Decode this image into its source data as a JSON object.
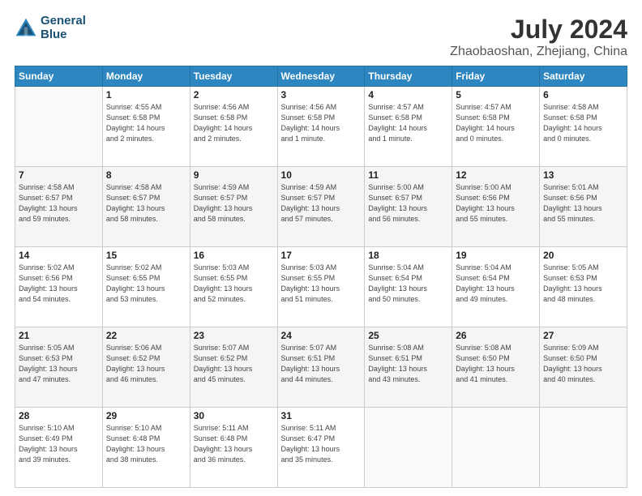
{
  "header": {
    "logo_line1": "General",
    "logo_line2": "Blue",
    "title": "July 2024",
    "subtitle": "Zhaobaoshan, Zhejiang, China"
  },
  "days_of_week": [
    "Sunday",
    "Monday",
    "Tuesday",
    "Wednesday",
    "Thursday",
    "Friday",
    "Saturday"
  ],
  "weeks": [
    [
      {
        "day": "",
        "info": ""
      },
      {
        "day": "1",
        "info": "Sunrise: 4:55 AM\nSunset: 6:58 PM\nDaylight: 14 hours\nand 2 minutes."
      },
      {
        "day": "2",
        "info": "Sunrise: 4:56 AM\nSunset: 6:58 PM\nDaylight: 14 hours\nand 2 minutes."
      },
      {
        "day": "3",
        "info": "Sunrise: 4:56 AM\nSunset: 6:58 PM\nDaylight: 14 hours\nand 1 minute."
      },
      {
        "day": "4",
        "info": "Sunrise: 4:57 AM\nSunset: 6:58 PM\nDaylight: 14 hours\nand 1 minute."
      },
      {
        "day": "5",
        "info": "Sunrise: 4:57 AM\nSunset: 6:58 PM\nDaylight: 14 hours\nand 0 minutes."
      },
      {
        "day": "6",
        "info": "Sunrise: 4:58 AM\nSunset: 6:58 PM\nDaylight: 14 hours\nand 0 minutes."
      }
    ],
    [
      {
        "day": "7",
        "info": "Sunrise: 4:58 AM\nSunset: 6:57 PM\nDaylight: 13 hours\nand 59 minutes."
      },
      {
        "day": "8",
        "info": "Sunrise: 4:58 AM\nSunset: 6:57 PM\nDaylight: 13 hours\nand 58 minutes."
      },
      {
        "day": "9",
        "info": "Sunrise: 4:59 AM\nSunset: 6:57 PM\nDaylight: 13 hours\nand 58 minutes."
      },
      {
        "day": "10",
        "info": "Sunrise: 4:59 AM\nSunset: 6:57 PM\nDaylight: 13 hours\nand 57 minutes."
      },
      {
        "day": "11",
        "info": "Sunrise: 5:00 AM\nSunset: 6:57 PM\nDaylight: 13 hours\nand 56 minutes."
      },
      {
        "day": "12",
        "info": "Sunrise: 5:00 AM\nSunset: 6:56 PM\nDaylight: 13 hours\nand 55 minutes."
      },
      {
        "day": "13",
        "info": "Sunrise: 5:01 AM\nSunset: 6:56 PM\nDaylight: 13 hours\nand 55 minutes."
      }
    ],
    [
      {
        "day": "14",
        "info": "Sunrise: 5:02 AM\nSunset: 6:56 PM\nDaylight: 13 hours\nand 54 minutes."
      },
      {
        "day": "15",
        "info": "Sunrise: 5:02 AM\nSunset: 6:55 PM\nDaylight: 13 hours\nand 53 minutes."
      },
      {
        "day": "16",
        "info": "Sunrise: 5:03 AM\nSunset: 6:55 PM\nDaylight: 13 hours\nand 52 minutes."
      },
      {
        "day": "17",
        "info": "Sunrise: 5:03 AM\nSunset: 6:55 PM\nDaylight: 13 hours\nand 51 minutes."
      },
      {
        "day": "18",
        "info": "Sunrise: 5:04 AM\nSunset: 6:54 PM\nDaylight: 13 hours\nand 50 minutes."
      },
      {
        "day": "19",
        "info": "Sunrise: 5:04 AM\nSunset: 6:54 PM\nDaylight: 13 hours\nand 49 minutes."
      },
      {
        "day": "20",
        "info": "Sunrise: 5:05 AM\nSunset: 6:53 PM\nDaylight: 13 hours\nand 48 minutes."
      }
    ],
    [
      {
        "day": "21",
        "info": "Sunrise: 5:05 AM\nSunset: 6:53 PM\nDaylight: 13 hours\nand 47 minutes."
      },
      {
        "day": "22",
        "info": "Sunrise: 5:06 AM\nSunset: 6:52 PM\nDaylight: 13 hours\nand 46 minutes."
      },
      {
        "day": "23",
        "info": "Sunrise: 5:07 AM\nSunset: 6:52 PM\nDaylight: 13 hours\nand 45 minutes."
      },
      {
        "day": "24",
        "info": "Sunrise: 5:07 AM\nSunset: 6:51 PM\nDaylight: 13 hours\nand 44 minutes."
      },
      {
        "day": "25",
        "info": "Sunrise: 5:08 AM\nSunset: 6:51 PM\nDaylight: 13 hours\nand 43 minutes."
      },
      {
        "day": "26",
        "info": "Sunrise: 5:08 AM\nSunset: 6:50 PM\nDaylight: 13 hours\nand 41 minutes."
      },
      {
        "day": "27",
        "info": "Sunrise: 5:09 AM\nSunset: 6:50 PM\nDaylight: 13 hours\nand 40 minutes."
      }
    ],
    [
      {
        "day": "28",
        "info": "Sunrise: 5:10 AM\nSunset: 6:49 PM\nDaylight: 13 hours\nand 39 minutes."
      },
      {
        "day": "29",
        "info": "Sunrise: 5:10 AM\nSunset: 6:48 PM\nDaylight: 13 hours\nand 38 minutes."
      },
      {
        "day": "30",
        "info": "Sunrise: 5:11 AM\nSunset: 6:48 PM\nDaylight: 13 hours\nand 36 minutes."
      },
      {
        "day": "31",
        "info": "Sunrise: 5:11 AM\nSunset: 6:47 PM\nDaylight: 13 hours\nand 35 minutes."
      },
      {
        "day": "",
        "info": ""
      },
      {
        "day": "",
        "info": ""
      },
      {
        "day": "",
        "info": ""
      }
    ]
  ]
}
